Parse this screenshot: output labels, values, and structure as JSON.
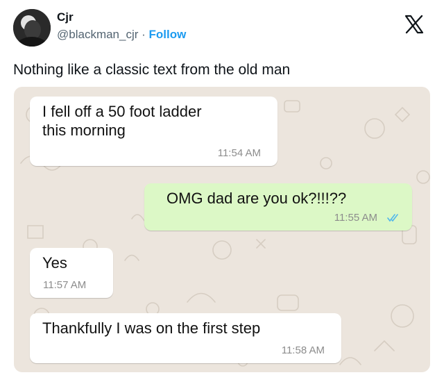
{
  "author": {
    "display_name": "Cjr",
    "handle": "@blackman_cjr",
    "separator": " · ",
    "follow_label": "Follow"
  },
  "header_icons": {
    "logo": "x-logo-icon"
  },
  "tweet": {
    "text": "Nothing like a classic text from the old man"
  },
  "chat": {
    "background_color": "#ece5dd",
    "incoming_bubble_color": "#ffffff",
    "outgoing_bubble_color": "#dcf8c6",
    "read_tick_color": "#4fb6ec",
    "messages": [
      {
        "direction": "incoming",
        "lines": [
          "I fell off a 50 foot ladder",
          "this morning"
        ],
        "time": "11:54 AM"
      },
      {
        "direction": "outgoing",
        "lines": [
          "OMG dad are you ok?!!!??"
        ],
        "time": "11:55 AM",
        "status_icon": "double-check-icon"
      },
      {
        "direction": "incoming",
        "lines": [
          "Yes"
        ],
        "time": "11:57 AM"
      },
      {
        "direction": "incoming",
        "lines": [
          "Thankfully I was on the first step"
        ],
        "time": "11:58 AM"
      }
    ]
  }
}
